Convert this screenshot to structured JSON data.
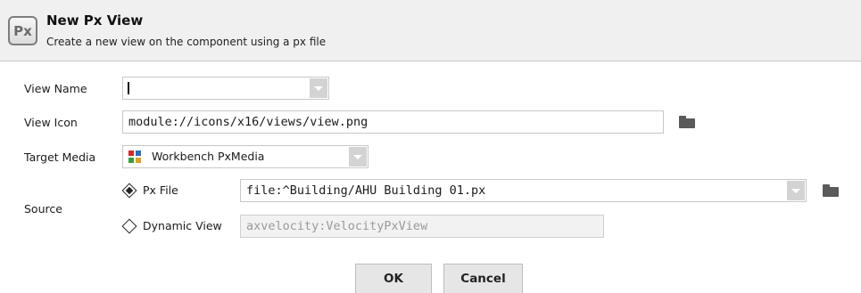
{
  "header": {
    "icon_text": "Px",
    "title": "New Px View",
    "subtitle": "Create a new view on the component using a px file"
  },
  "form": {
    "view_name": {
      "label": "View Name",
      "value": ""
    },
    "view_icon": {
      "label": "View Icon",
      "value": "module://icons/x16/views/view.png"
    },
    "target_media": {
      "label": "Target Media",
      "value": "Workbench PxMedia"
    },
    "source": {
      "label": "Source",
      "px_file": {
        "label": "Px File",
        "selected": true,
        "value": "file:^Building/AHU Building 01.px"
      },
      "dynamic_view": {
        "label": "Dynamic View",
        "selected": false,
        "value": "axvelocity:VelocityPxView"
      }
    }
  },
  "buttons": {
    "ok": "OK",
    "cancel": "Cancel"
  },
  "icons": {
    "header": "px-file-icon",
    "folder": "folder-icon",
    "media": "workbench-media-icon",
    "dropdown": "chevron-down-icon"
  },
  "colors": {
    "header_bg": "#f0f0f0",
    "button_bg": "#e6e6e6",
    "dropdown_arrow_bg": "#d3d3d3"
  }
}
